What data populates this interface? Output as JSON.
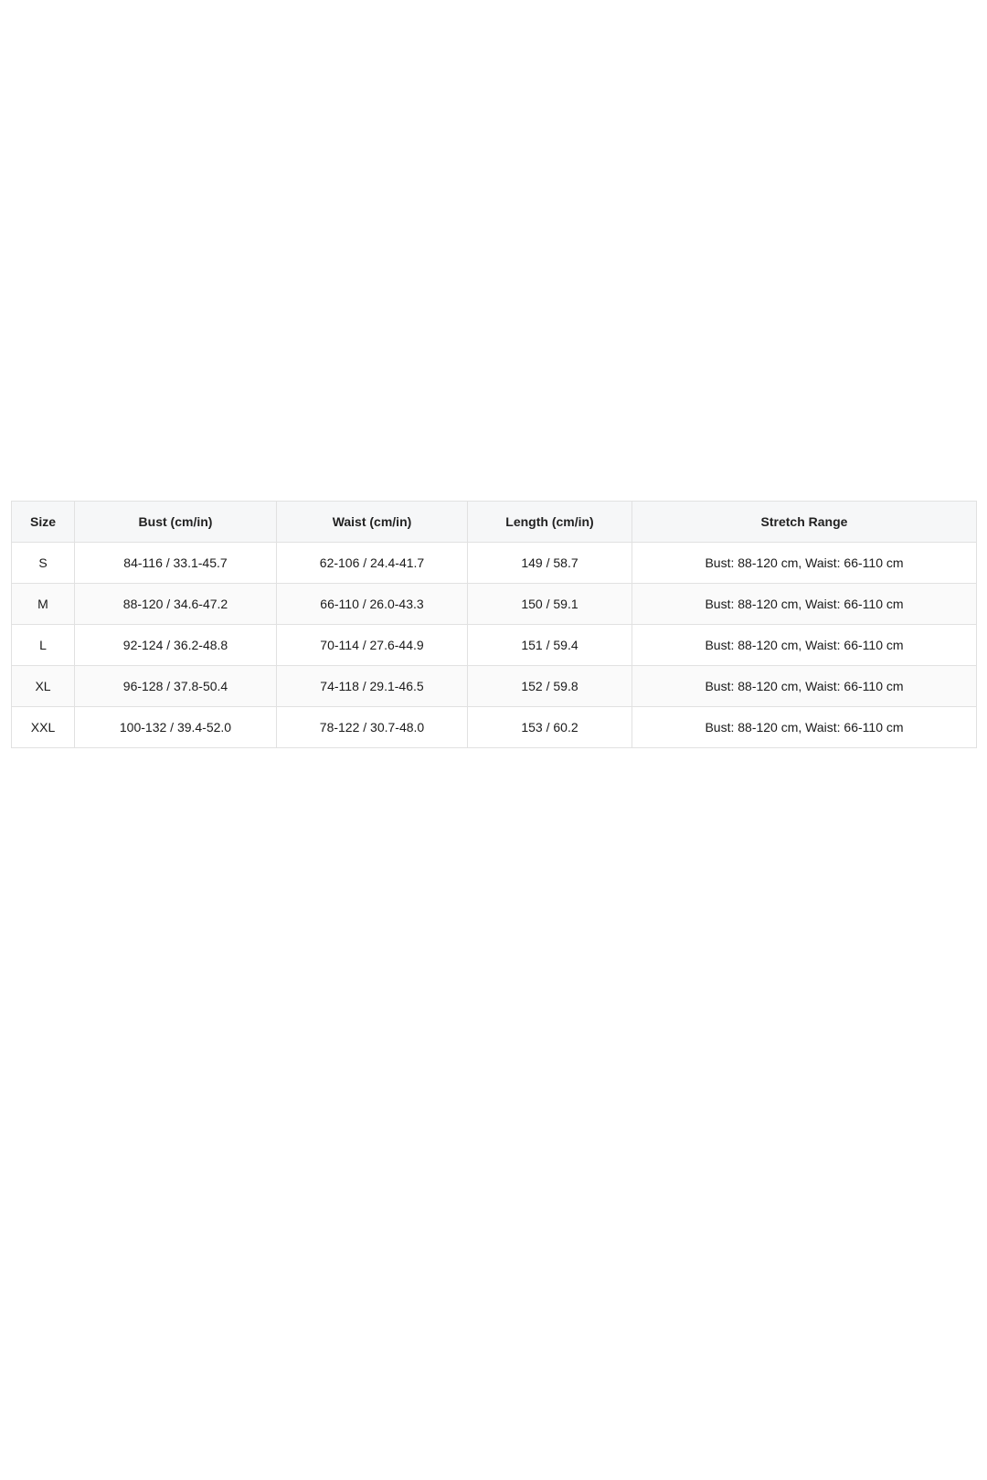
{
  "size_chart": {
    "headers": [
      "Size",
      "Bust (cm/in)",
      "Waist (cm/in)",
      "Length (cm/in)",
      "Stretch Range"
    ],
    "rows": [
      [
        "S",
        "84-116 / 33.1-45.7",
        "62-106 / 24.4-41.7",
        "149 / 58.7",
        "Bust: 88-120 cm, Waist: 66-110 cm"
      ],
      [
        "M",
        "88-120 / 34.6-47.2",
        "66-110 / 26.0-43.3",
        "150 / 59.1",
        "Bust: 88-120 cm, Waist: 66-110 cm"
      ],
      [
        "L",
        "92-124 / 36.2-48.8",
        "70-114 / 27.6-44.9",
        "151 / 59.4",
        "Bust: 88-120 cm, Waist: 66-110 cm"
      ],
      [
        "XL",
        "96-128 / 37.8-50.4",
        "74-118 / 29.1-46.5",
        "152 / 59.8",
        "Bust: 88-120 cm, Waist: 66-110 cm"
      ],
      [
        "XXL",
        "100-132 / 39.4-52.0",
        "78-122 / 30.7-48.0",
        "153 / 60.2",
        "Bust: 88-120 cm, Waist: 66-110 cm"
      ]
    ]
  }
}
